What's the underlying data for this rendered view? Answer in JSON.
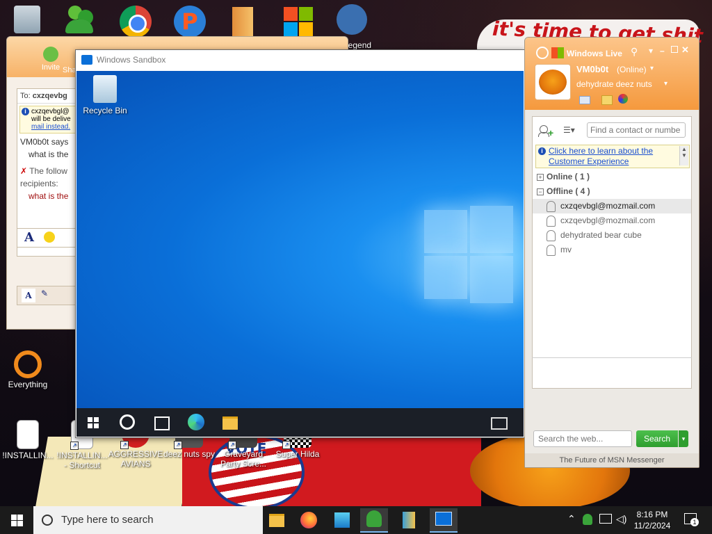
{
  "desktop": {
    "banner_text": "it's time to get shit",
    "legend_label": "Legend",
    "icons_bottom": [
      {
        "label": "!INSTALLIN..."
      },
      {
        "label": "!INSTALLIN... - Shortcut"
      },
      {
        "label": "AGGRESSIVE AVIANS"
      },
      {
        "label": "deez nuts spy"
      },
      {
        "label": "Graveyard Party Scre..."
      },
      {
        "label": "Super Hilda"
      }
    ],
    "everything_label": "Everything",
    "vote_text": "VOTE"
  },
  "chat_window": {
    "invite_label": "Invite",
    "share_label": "Sha",
    "to_label": "To:",
    "to_value": "cxzqevbg",
    "notice_lines": [
      "cxzqevbgl@",
      "will be delive",
      "mail instead."
    ],
    "sender_says": "VM0b0t says",
    "msg1": "what is the",
    "follow_text": "The follow",
    "recipients": "recipients:",
    "msg2": "what is the"
  },
  "sandbox": {
    "title": "Windows Sandbox",
    "recycle_bin_label": "Recycle Bin"
  },
  "msn": {
    "brand": "Windows Live",
    "display_name": "VM0b0t",
    "status": "(Online)",
    "personal_message": "dehydrate deez nuts",
    "search_contacts_placeholder": "Find a contact or numbe",
    "notice_text": "Click here to learn about the Customer Experience",
    "groups": [
      {
        "label": "Online ( 1 )",
        "toggle": "+"
      },
      {
        "label": "Offline ( 4 )",
        "toggle": "−"
      }
    ],
    "contacts": [
      {
        "name": "cxzqevbgl@mozmail.com",
        "selected": true
      },
      {
        "name": "cxzqevbgl@mozmail.com",
        "selected": false
      },
      {
        "name": "dehydrated bear cube",
        "selected": false
      },
      {
        "name": "mv",
        "selected": false
      }
    ],
    "web_search_placeholder": "Search the web...",
    "search_button": "Search",
    "footer": "The Future of MSN Messenger"
  },
  "taskbar": {
    "search_placeholder": "Type here to search",
    "time": "8:16 PM",
    "date": "11/2/2024",
    "notification_count": "1"
  },
  "colors": {
    "msn_orange": "#f5993d",
    "sandbox_blue": "#0a6fd8",
    "search_green": "#2f9e2f"
  }
}
